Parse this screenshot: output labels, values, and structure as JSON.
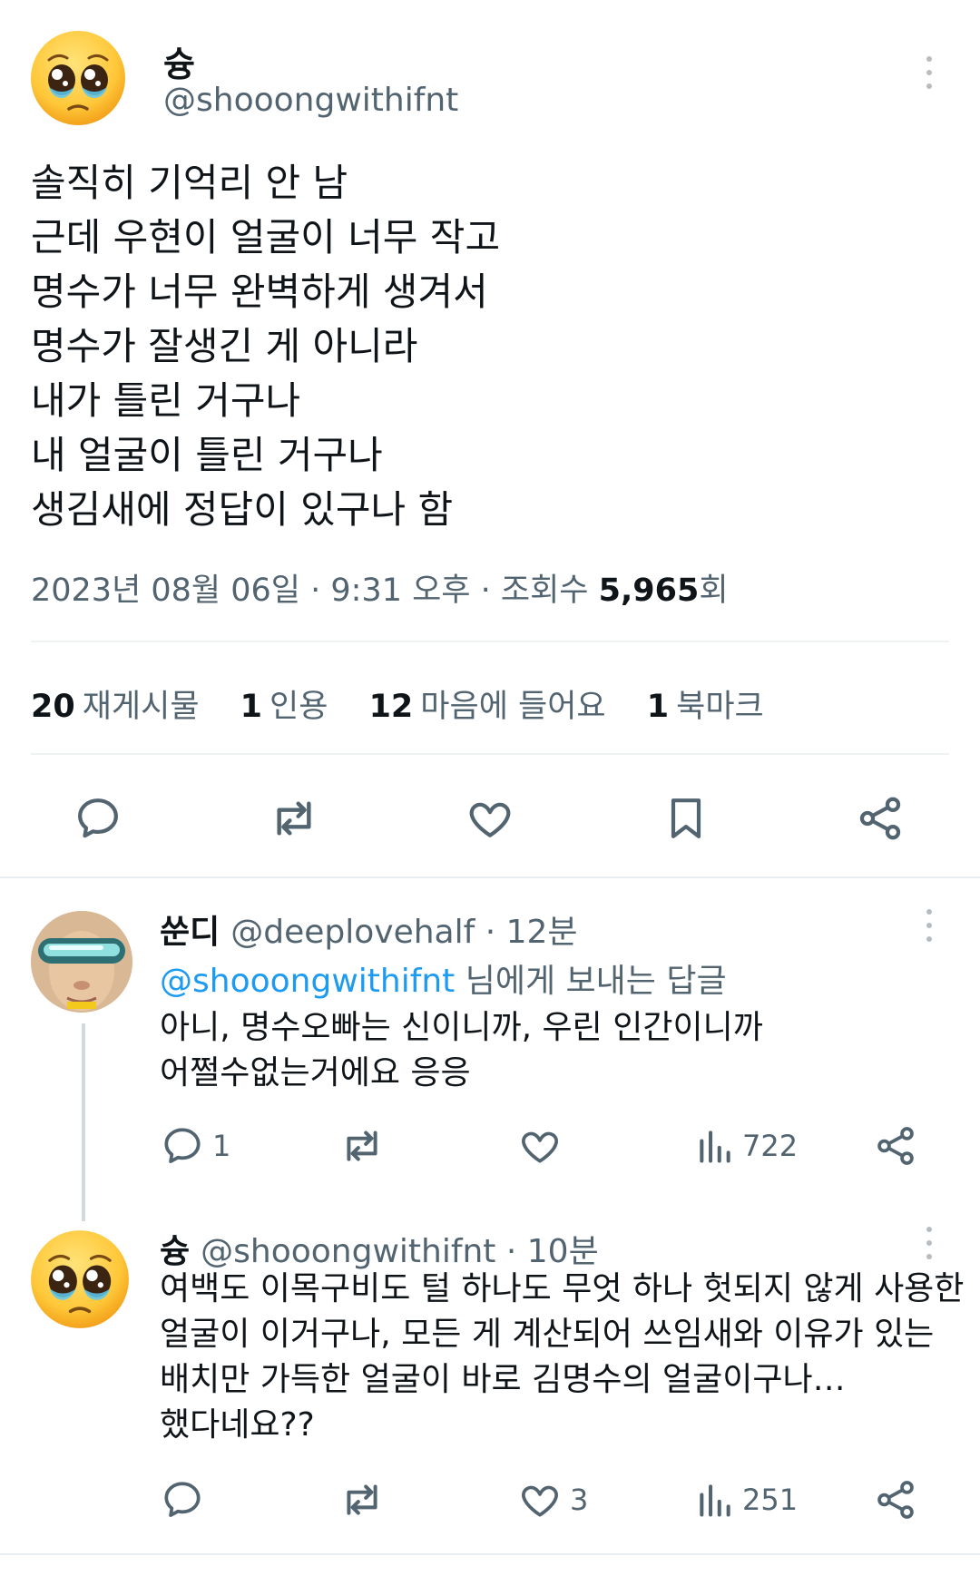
{
  "main_tweet": {
    "author_name": "슝",
    "author_handle": "@shooongwithifnt",
    "body_lines": [
      "솔직히 기억리 안 남",
      "근데 우현이 얼굴이 너무 작고",
      "명수가 너무 완벽하게 생겨서",
      "명수가 잘생긴 게 아니라",
      "내가 틀린 거구나",
      "내 얼굴이 틀린 거구나",
      "생김새에 정답이 있구나 함"
    ],
    "meta_prefix": "2023년 08월 06일 · 9:31 오후 · 조회수 ",
    "views": "5,965",
    "views_suffix": "회",
    "stats": [
      {
        "num": "20",
        "label": "재게시물"
      },
      {
        "num": "1",
        "label": "인용"
      },
      {
        "num": "12",
        "label": "마음에 들어요"
      },
      {
        "num": "1",
        "label": "북마크"
      }
    ]
  },
  "replies": [
    {
      "name": "쑨디",
      "handle_time": "@deeplovehalf · 12분",
      "reply_to_handle": "@shooongwithifnt",
      "reply_to_suffix": " 님에게 보내는 답글",
      "lines": [
        "아니, 명수오빠는 신이니까, 우린 인간이니까",
        "어쩔수없는거에요 응응"
      ],
      "reply_count": "1",
      "repost_count": "",
      "like_count": "",
      "view_count": "722"
    },
    {
      "name": "슝",
      "handle_time": "@shooongwithifnt · 10분",
      "lines": [
        "여백도 이목구비도 털 하나도 무엇 하나 헛되지 않게 사용한",
        "얼굴이 이거구나, 모든 게 계산되어 쓰임새와 이유가 있는",
        "배치만 가득한 얼굴이 바로 김명수의 얼굴이구나…",
        "했다네요??"
      ],
      "reply_count": "",
      "repost_count": "",
      "like_count": "3",
      "view_count": "251"
    }
  ],
  "icons": {
    "reply": "speech-bubble-icon",
    "repost": "repost-arrows-icon",
    "like": "heart-icon",
    "bookmark": "bookmark-icon",
    "share": "share-icon",
    "views": "bar-chart-icon",
    "more": "vertical-dots-icon"
  },
  "colors": {
    "text": "#0f1419",
    "muted": "#536471",
    "link": "#1d9bf0",
    "divider": "#eff3f4"
  }
}
